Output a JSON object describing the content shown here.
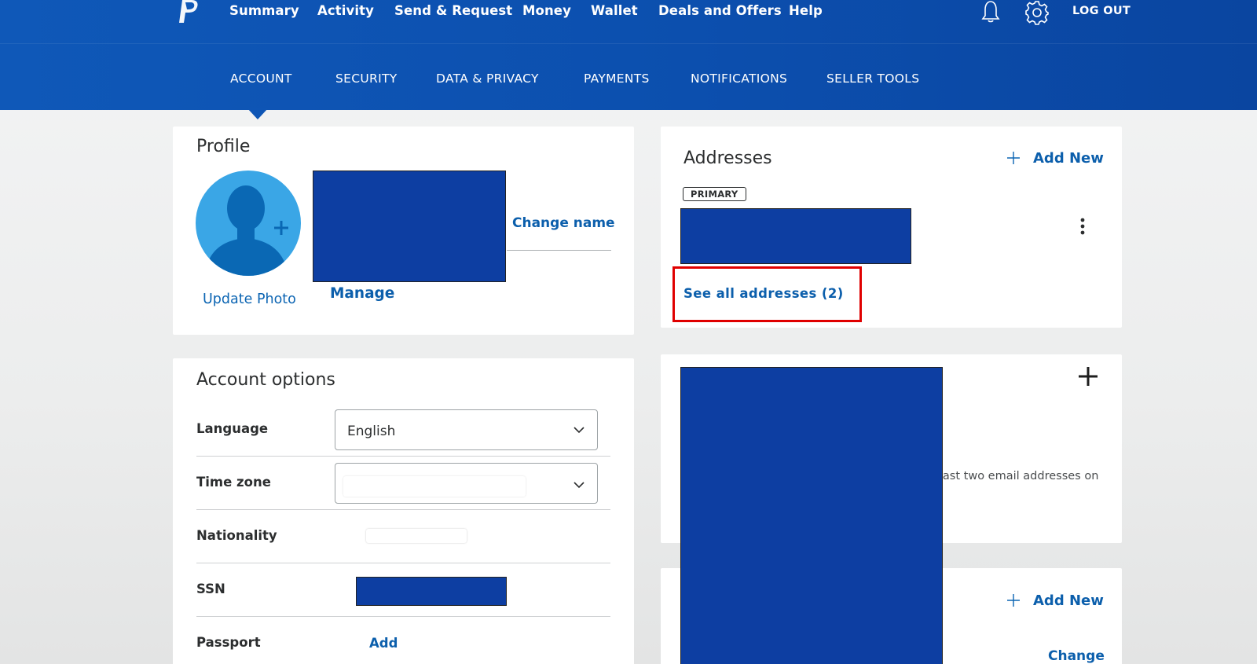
{
  "topnav": {
    "items": [
      {
        "label": "Summary"
      },
      {
        "label": "Activity"
      },
      {
        "label": "Send & Request"
      },
      {
        "label": "Money"
      },
      {
        "label": "Wallet"
      },
      {
        "label": "Deals and Offers"
      },
      {
        "label": "Help"
      }
    ],
    "logout_label": "LOG OUT",
    "icons": [
      "paypal-logo",
      "bell-icon",
      "gear-icon"
    ]
  },
  "subnav": {
    "items": [
      {
        "label": "ACCOUNT",
        "active": true
      },
      {
        "label": "SECURITY"
      },
      {
        "label": "DATA & PRIVACY"
      },
      {
        "label": "PAYMENTS"
      },
      {
        "label": "NOTIFICATIONS"
      },
      {
        "label": "SELLER TOOLS"
      }
    ]
  },
  "profile": {
    "title": "Profile",
    "update_photo_label": "Update Photo",
    "change_name_label": "Change name",
    "manage_label": "Manage"
  },
  "account_options": {
    "title": "Account options",
    "rows": [
      {
        "label": "Language",
        "value": "English"
      },
      {
        "label": "Time zone",
        "value": ""
      },
      {
        "label": "Nationality",
        "value": ""
      },
      {
        "label": "SSN",
        "value": ""
      },
      {
        "label": "Passport",
        "action": "Add"
      }
    ]
  },
  "addresses": {
    "title": "Addresses",
    "add_new_label": "Add New",
    "badge": "PRIMARY",
    "see_all_label": "See all addresses (2)"
  },
  "emails": {
    "note_fragment": "east two email addresses on"
  },
  "phones": {
    "add_new_label": "Add New",
    "change_label": "Change"
  },
  "colors": {
    "header_blue": "#0c4fae",
    "link_blue": "#0c65b3",
    "redaction_blue": "#0d3ea2",
    "highlight_red": "#e00000",
    "avatar_blue": "#3aa6e6"
  }
}
